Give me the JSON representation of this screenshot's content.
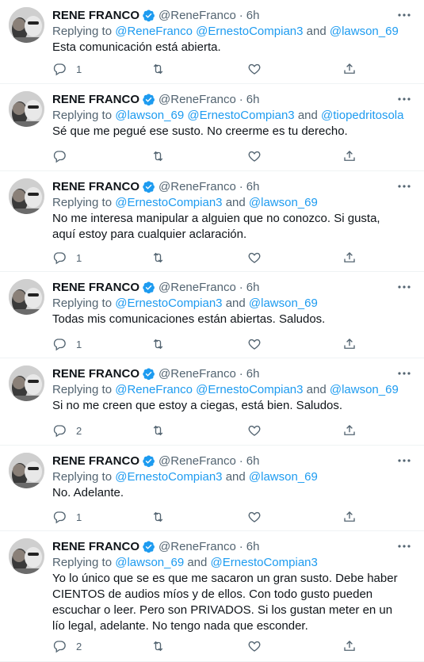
{
  "colors": {
    "accent": "#1d9bf0",
    "secondary_text": "#536471",
    "primary_text": "#0f1419",
    "divider": "#eff3f4"
  },
  "icons": [
    "avatar",
    "verified-badge-icon",
    "more-icon",
    "reply-icon",
    "retweet-icon",
    "like-icon",
    "share-icon"
  ],
  "tweets": [
    {
      "name": "RENE FRANCO",
      "handle": "@ReneFranco",
      "time": "6h",
      "replying_prefix": "Replying to",
      "mentions": [
        {
          "text": "@ReneFranco"
        },
        {
          "text": "@ErnestoCompian3"
        },
        {
          "text": "and"
        },
        {
          "text": "@lawson_69"
        }
      ],
      "text": "Esta comunicación está abierta.",
      "reply_count": "1"
    },
    {
      "name": "RENE FRANCO",
      "handle": "@ReneFranco",
      "time": "6h",
      "replying_prefix": "Replying to",
      "mentions": [
        {
          "text": "@lawson_69"
        },
        {
          "text": "@ErnestoCompian3"
        },
        {
          "text": "and"
        },
        {
          "text": "@tiopedritosola"
        }
      ],
      "text": "Sé que me pegué ese susto. No creerme es tu derecho.",
      "reply_count": ""
    },
    {
      "name": "RENE FRANCO",
      "handle": "@ReneFranco",
      "time": "6h",
      "replying_prefix": "Replying to",
      "mentions": [
        {
          "text": "@ErnestoCompian3"
        },
        {
          "text": "and"
        },
        {
          "text": "@lawson_69"
        }
      ],
      "text": "No me interesa manipular a alguien que no conozco. Si gusta, aquí estoy para cualquier aclaración.",
      "reply_count": "1"
    },
    {
      "name": "RENE FRANCO",
      "handle": "@ReneFranco",
      "time": "6h",
      "replying_prefix": "Replying to",
      "mentions": [
        {
          "text": "@ErnestoCompian3"
        },
        {
          "text": "and"
        },
        {
          "text": "@lawson_69"
        }
      ],
      "text": "Todas mis comunicaciones están abiertas. Saludos.",
      "reply_count": "1"
    },
    {
      "name": "RENE FRANCO",
      "handle": "@ReneFranco",
      "time": "6h",
      "replying_prefix": "Replying to",
      "mentions": [
        {
          "text": "@ReneFranco"
        },
        {
          "text": "@ErnestoCompian3"
        },
        {
          "text": "and"
        },
        {
          "text": "@lawson_69"
        }
      ],
      "text": "Si no me creen que estoy a ciegas, está bien. Saludos.",
      "reply_count": "2"
    },
    {
      "name": "RENE FRANCO",
      "handle": "@ReneFranco",
      "time": "6h",
      "replying_prefix": "Replying to",
      "mentions": [
        {
          "text": "@ErnestoCompian3"
        },
        {
          "text": "and"
        },
        {
          "text": "@lawson_69"
        }
      ],
      "text": "No. Adelante.",
      "reply_count": "1"
    },
    {
      "name": "RENE FRANCO",
      "handle": "@ReneFranco",
      "time": "6h",
      "replying_prefix": "Replying to",
      "mentions": [
        {
          "text": "@lawson_69"
        },
        {
          "text": "and"
        },
        {
          "text": "@ErnestoCompian3"
        }
      ],
      "text": "Yo lo único que se es que me sacaron un gran susto. Debe haber CIENTOS de audios míos y de ellos. Con todo gusto pueden escuchar o leer. Pero son PRIVADOS. Si los gustan meter en un lío legal, adelante. No tengo nada que esconder.",
      "reply_count": "2"
    }
  ]
}
